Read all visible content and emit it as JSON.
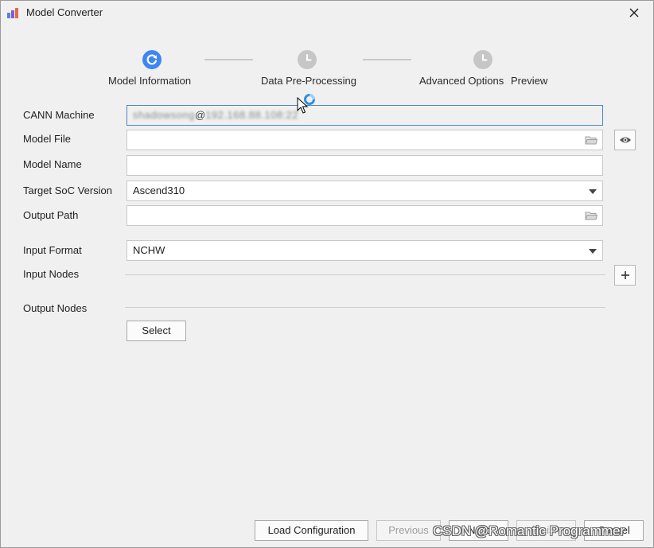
{
  "window": {
    "title": "Model Converter",
    "icon": "app-logo-icon",
    "close_icon": "close-icon"
  },
  "stepper": {
    "steps": [
      {
        "label": "Model Information",
        "state": "active",
        "icon": "refresh-icon"
      },
      {
        "label": "Data Pre-Processing",
        "state": "pending",
        "icon": "clock-icon"
      },
      {
        "label": "Advanced Options",
        "state": "pending",
        "icon": "clock-icon"
      },
      {
        "label": "Preview",
        "state": "pending"
      }
    ],
    "active_color": "#3f86f2",
    "pending_color": "#c6c6c6"
  },
  "form": {
    "cann_machine": {
      "label": "CANN Machine",
      "value_prefix_blurred": "shadowsong",
      "value_at": "@",
      "value_suffix_blurred": "192.168.88.108:22"
    },
    "model_file": {
      "label": "Model File",
      "value": "",
      "icon": "folder-icon",
      "side_icon": "eye-icon"
    },
    "model_name": {
      "label": "Model Name",
      "value": ""
    },
    "target_soc": {
      "label": "Target SoC Version",
      "value": "Ascend310"
    },
    "output_path": {
      "label": "Output Path",
      "value": "",
      "icon": "folder-icon"
    },
    "input_format": {
      "label": "Input Format",
      "value": "NCHW"
    },
    "input_nodes": {
      "label": "Input Nodes",
      "side_icon": "plus-icon"
    },
    "output_nodes": {
      "label": "Output Nodes",
      "select_label": "Select"
    }
  },
  "footer": {
    "load_configuration": "Load Configuration",
    "previous": "Previous",
    "next": "Next",
    "finish": "Finish",
    "cancel": "Cancel"
  },
  "watermark": "CSDN @Romantic Programmer",
  "colors": {
    "focus_border": "#4a86c7",
    "background": "#f0f0f0"
  }
}
